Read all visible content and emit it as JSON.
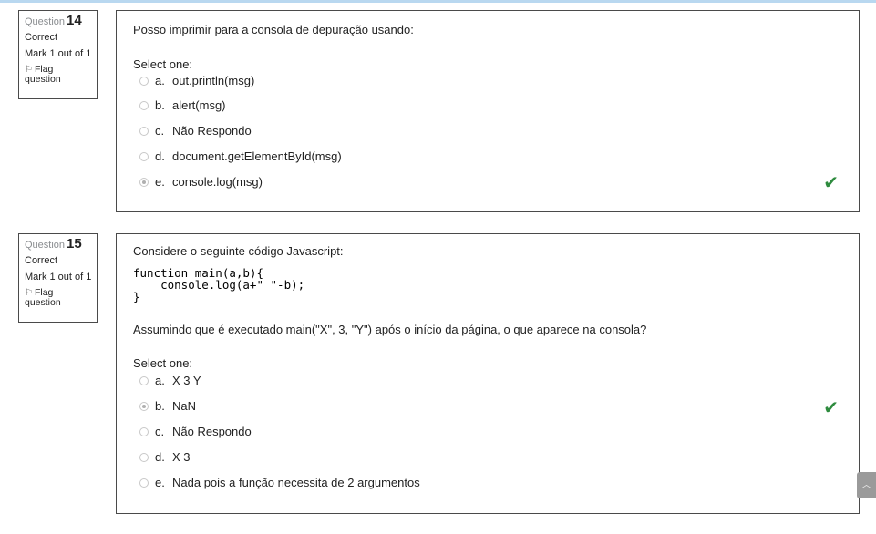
{
  "questions": [
    {
      "label": "Question",
      "number": "14",
      "state": "Correct",
      "mark": "Mark 1 out of 1",
      "flag_label": "Flag question",
      "text": "Posso imprimir para a consola de depuração usando:",
      "select_label": "Select one:",
      "options": [
        {
          "letter": "a.",
          "text": "out.println(msg)",
          "selected": false
        },
        {
          "letter": "b.",
          "text": "alert(msg)",
          "selected": false
        },
        {
          "letter": "c.",
          "text": "Não Respondo",
          "selected": false
        },
        {
          "letter": "d.",
          "text": "document.getElementById(msg)",
          "selected": false
        },
        {
          "letter": "e.",
          "text": "console.log(msg)",
          "selected": true
        }
      ],
      "result_icon": "check-icon"
    },
    {
      "label": "Question",
      "number": "15",
      "state": "Correct",
      "mark": "Mark 1 out of 1",
      "flag_label": "Flag question",
      "text": "Considere o seguinte código Javascript:",
      "code": "function main(a,b){\n    console.log(a+\" \"-b);\n}",
      "text2": "Assumindo que é executado main(\"X\", 3, \"Y\") após o início da página, o que aparece na consola?",
      "select_label": "Select one:",
      "options": [
        {
          "letter": "a.",
          "text": "X 3 Y",
          "selected": false
        },
        {
          "letter": "b.",
          "text": "NaN",
          "selected": true
        },
        {
          "letter": "c.",
          "text": "Não Respondo",
          "selected": false
        },
        {
          "letter": "d.",
          "text": "X 3",
          "selected": false
        },
        {
          "letter": "e.",
          "text": "Nada pois a função necessita de 2 argumentos",
          "selected": false
        }
      ],
      "result_icon": "check-icon"
    }
  ],
  "colors": {
    "correct_check": "#2e8b3e",
    "border": "#4a4a4a",
    "top_line": "#b9d8f0"
  },
  "scroll_top_icon": "chevron-up-icon"
}
